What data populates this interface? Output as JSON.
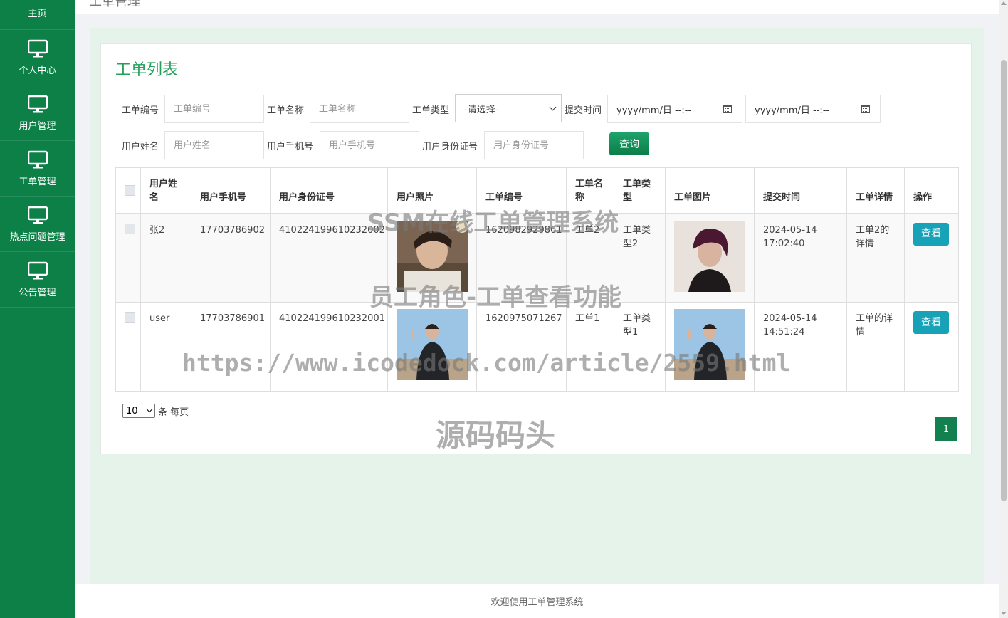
{
  "header": {
    "title": "工单管理"
  },
  "sidebar": {
    "home": "主页",
    "items": [
      {
        "label": "个人中心",
        "icon": "monitor-icon"
      },
      {
        "label": "用户管理",
        "icon": "monitor-icon"
      },
      {
        "label": "工单管理",
        "icon": "monitor-icon"
      },
      {
        "label": "热点问题管理",
        "icon": "monitor-icon"
      },
      {
        "label": "公告管理",
        "icon": "monitor-icon"
      }
    ]
  },
  "card": {
    "title": "工单列表"
  },
  "filters": {
    "order_no": {
      "label": "工单编号",
      "placeholder": "工单编号"
    },
    "order_name": {
      "label": "工单名称",
      "placeholder": "工单名称"
    },
    "order_type": {
      "label": "工单类型",
      "value": "-请选择-"
    },
    "submit_time": {
      "label": "提交时间",
      "start": "yyyy/mm/日  --:--",
      "end": "yyyy/mm/日  --:--"
    },
    "user_name": {
      "label": "用户姓名",
      "placeholder": "用户姓名"
    },
    "user_phone": {
      "label": "用户手机号",
      "placeholder": "用户手机号"
    },
    "user_id": {
      "label": "用户身份证号",
      "placeholder": "用户身份证号"
    },
    "query_button": "查询"
  },
  "table": {
    "headers": {
      "name": "用户姓名",
      "phone": "用户手机号",
      "idcard": "用户身份证号",
      "photo": "用户照片",
      "order_no": "工单编号",
      "order_name": "工单名称",
      "order_type": "工单类型",
      "order_image": "工单图片",
      "submit_time": "提交时间",
      "detail": "工单详情",
      "action": "操作"
    },
    "rows": [
      {
        "name": "张2",
        "phone": "17703786902",
        "idcard": "410224199610232002",
        "order_no": "1620982929861",
        "order_name": "工单2",
        "order_type": "工单类型2",
        "submit_time": "2024-05-14 17:02:40",
        "detail": "工单2的详情",
        "action": "查看"
      },
      {
        "name": "user",
        "phone": "17703786901",
        "idcard": "410224199610232001",
        "order_no": "1620975071267",
        "order_name": "工单1",
        "order_type": "工单类型1",
        "submit_time": "2024-05-14 14:51:24",
        "detail": "工单的详情",
        "action": "查看"
      }
    ]
  },
  "pagination": {
    "page_size": "10",
    "per_page_label": "条 每页",
    "current_page": "1"
  },
  "footer": {
    "text": "欢迎使用工单管理系统"
  },
  "watermarks": {
    "line1": "SSM在线工单管理系统",
    "line2": "员工角色-工单查看功能",
    "line3": "https://www.icodedock.com/article/2559.html",
    "line4": "源码码头"
  },
  "colors": {
    "sidebar": "#0d8048",
    "accent": "#23a05a",
    "view_button": "#17a2b8"
  }
}
